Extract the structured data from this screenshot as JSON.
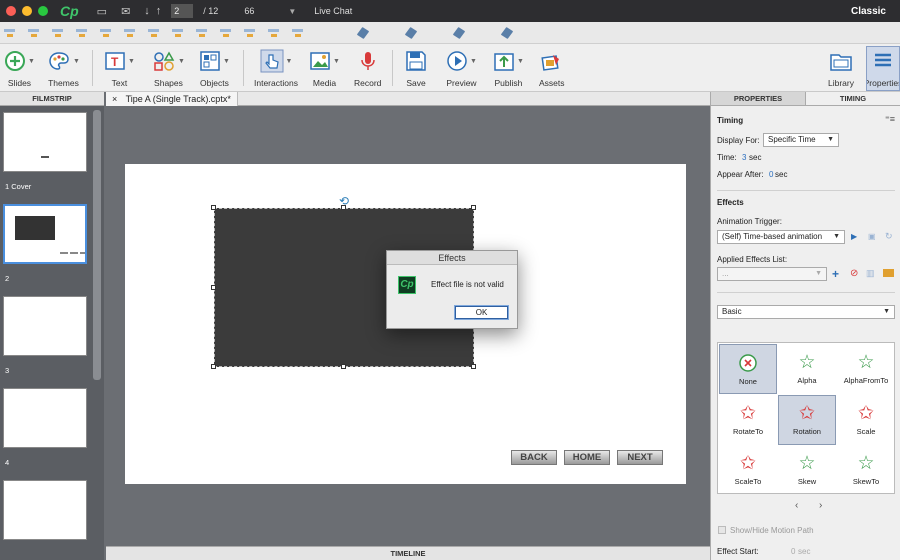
{
  "titlebar": {
    "app_logo": "Cp",
    "slide_current": "2",
    "slide_total": "/ 12",
    "zoom": "66",
    "live_chat": "Live Chat",
    "workspace": "Classic"
  },
  "toolbar": {
    "items": [
      {
        "label": "Slides",
        "icon": "plus-circle-icon"
      },
      {
        "label": "Themes",
        "icon": "palette-icon"
      },
      {
        "label": "Text",
        "icon": "text-box-icon"
      },
      {
        "label": "Shapes",
        "icon": "shapes-icon"
      },
      {
        "label": "Objects",
        "icon": "objects-icon"
      },
      {
        "label": "Interactions",
        "icon": "hand-pointer-icon"
      },
      {
        "label": "Media",
        "icon": "image-icon"
      },
      {
        "label": "Record",
        "icon": "microphone-icon"
      },
      {
        "label": "Save",
        "icon": "floppy-icon"
      },
      {
        "label": "Preview",
        "icon": "play-icon"
      },
      {
        "label": "Publish",
        "icon": "publish-icon"
      },
      {
        "label": "Assets",
        "icon": "assets-icon"
      },
      {
        "label": "Library",
        "icon": "folder-icon"
      },
      {
        "label": "Properties",
        "icon": "list-icon"
      }
    ]
  },
  "filmstrip": {
    "header": "FILMSTRIP",
    "slides": [
      {
        "label": "1 Cover"
      },
      {
        "label": "2"
      },
      {
        "label": "3"
      },
      {
        "label": "4"
      }
    ]
  },
  "document": {
    "tab_title": "Tipe A (Single Track).cptx*",
    "tab_close": "×"
  },
  "stage": {
    "buttons": [
      "BACK",
      "HOME",
      "NEXT"
    ]
  },
  "timeline": {
    "label": "TIMELINE"
  },
  "dialog": {
    "title": "Effects",
    "icon_text": "Cp",
    "message": "Effect file is not valid",
    "ok": "OK"
  },
  "properties": {
    "tabs": {
      "properties": "PROPERTIES",
      "timing": "TIMING"
    },
    "timing_heading": "Timing",
    "display_for_label": "Display For:",
    "display_for_value": "Specific Time",
    "time_label": "Time:",
    "time_value": "3",
    "time_unit": "sec",
    "appear_after_label": "Appear After:",
    "appear_after_value": "0",
    "appear_after_unit": "sec",
    "effects_heading": "Effects",
    "animation_trigger_label": "Animation Trigger:",
    "animation_trigger_value": "(Self) Time-based animation",
    "applied_effects_label": "Applied Effects List:",
    "applied_effects_value": "...",
    "category_value": "Basic",
    "effects": [
      {
        "label": "None"
      },
      {
        "label": "Alpha"
      },
      {
        "label": "AlphaFromTo"
      },
      {
        "label": "RotateTo"
      },
      {
        "label": "Rotation"
      },
      {
        "label": "Scale"
      },
      {
        "label": "ScaleTo"
      },
      {
        "label": "Skew"
      },
      {
        "label": "SkewTo"
      }
    ],
    "show_motion_path": "Show/Hide Motion Path",
    "effect_start_label": "Effect Start:",
    "effect_start_value": "0",
    "effect_start_unit": "sec"
  }
}
